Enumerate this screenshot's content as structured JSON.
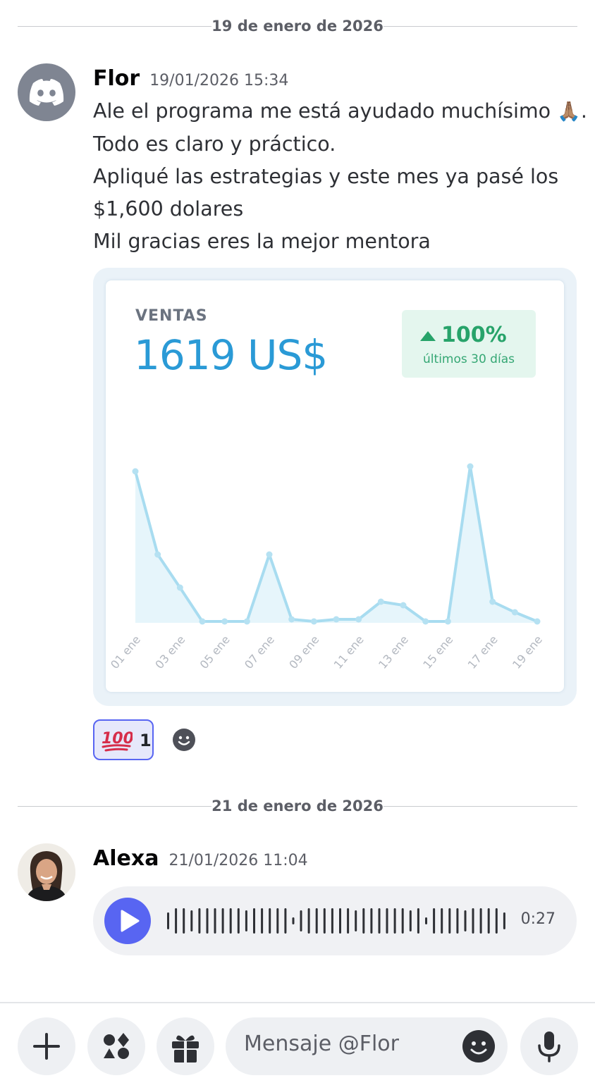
{
  "dividers": {
    "first": "19 de enero de 2026",
    "second": "21 de enero de 2026"
  },
  "message1": {
    "author": "Flor",
    "timestamp": "19/01/2026 15:34",
    "lines": [
      "Ale el programa me está ayudado muchísimo",
      "Todo es claro y práctico.",
      "Apliqué las estrategias y este mes ya pasé los",
      "$1,600 dolares",
      "Mil gracias eres la mejor mentora"
    ],
    "line1_emoji": "🙏🏽",
    "line1_end": ".",
    "avatar_icon": "discord-logo-icon",
    "attachment": {
      "label": "VENTAS",
      "value": "1619 US$",
      "change": "100%",
      "change_period": "últimos 30 días",
      "change_color": "#27a36a",
      "line_color": "#a8dcf0"
    },
    "reaction": {
      "emoji": "💯",
      "count": "1"
    }
  },
  "chart_data": {
    "type": "area",
    "categories": [
      "01 ene",
      "02 ene",
      "03 ene",
      "04 ene",
      "05 ene",
      "06 ene",
      "07 ene",
      "08 ene",
      "09 ene",
      "10 ene",
      "11 ene",
      "12 ene",
      "13 ene",
      "14 ene",
      "15 ene",
      "16 ene",
      "17 ene",
      "18 ene",
      "19 ene"
    ],
    "tick_labels": [
      "01 ene",
      "03 ene",
      "05 ene",
      "07 ene",
      "09 ene",
      "11 ene",
      "13 ene",
      "15 ene",
      "17 ene",
      "19 ene"
    ],
    "values": [
      215,
      97,
      50,
      2,
      2,
      2,
      97,
      5,
      2,
      5,
      5,
      30,
      25,
      2,
      2,
      222,
      30,
      15,
      2
    ],
    "ylim": [
      0,
      240
    ],
    "grid": false
  },
  "message2": {
    "author": "Alexa",
    "timestamp": "21/01/2026 11:04",
    "audio_duration": "0:27"
  },
  "composer": {
    "placeholder": "Mensaje @Flor"
  }
}
